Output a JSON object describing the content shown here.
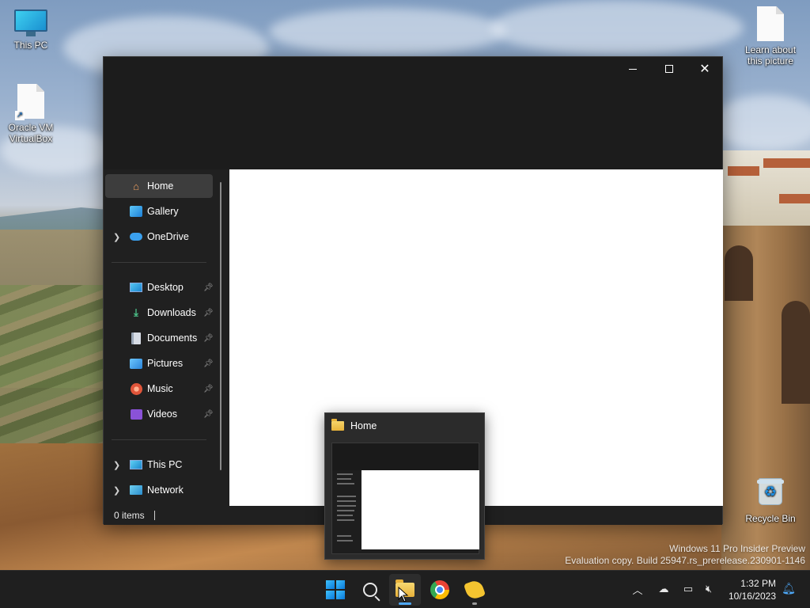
{
  "desktop": {
    "icons": {
      "this_pc": "This PC",
      "virtualbox": "Oracle VM VirtualBox",
      "learn_picture": "Learn about this picture",
      "recycle_bin": "Recycle Bin"
    },
    "watermark": {
      "line1": "Windows 11 Pro Insider Preview",
      "line2": "Evaluation copy. Build 25947.rs_prerelease.230901-1146"
    }
  },
  "explorer": {
    "title_buttons": {
      "minimize": "minimize-icon",
      "maximize": "maximize-icon",
      "close": "close-icon"
    },
    "nav": {
      "home": "Home",
      "gallery": "Gallery",
      "onedrive": "OneDrive",
      "desktop": "Desktop",
      "downloads": "Downloads",
      "documents": "Documents",
      "pictures": "Pictures",
      "music": "Music",
      "videos": "Videos",
      "this_pc": "This PC",
      "network": "Network"
    },
    "status": {
      "items": "0 items"
    }
  },
  "preview": {
    "title": "Home"
  },
  "taskbar": {
    "apps": [
      "windows-logo-icon",
      "search-icon",
      "file-explorer-icon",
      "chrome-icon",
      "feedback-hub-icon"
    ],
    "clock": {
      "time": "1:32 PM",
      "date": "10/16/2023"
    },
    "colors": {
      "accent": "#4ea8f7",
      "running": "#4ea8f7"
    }
  }
}
